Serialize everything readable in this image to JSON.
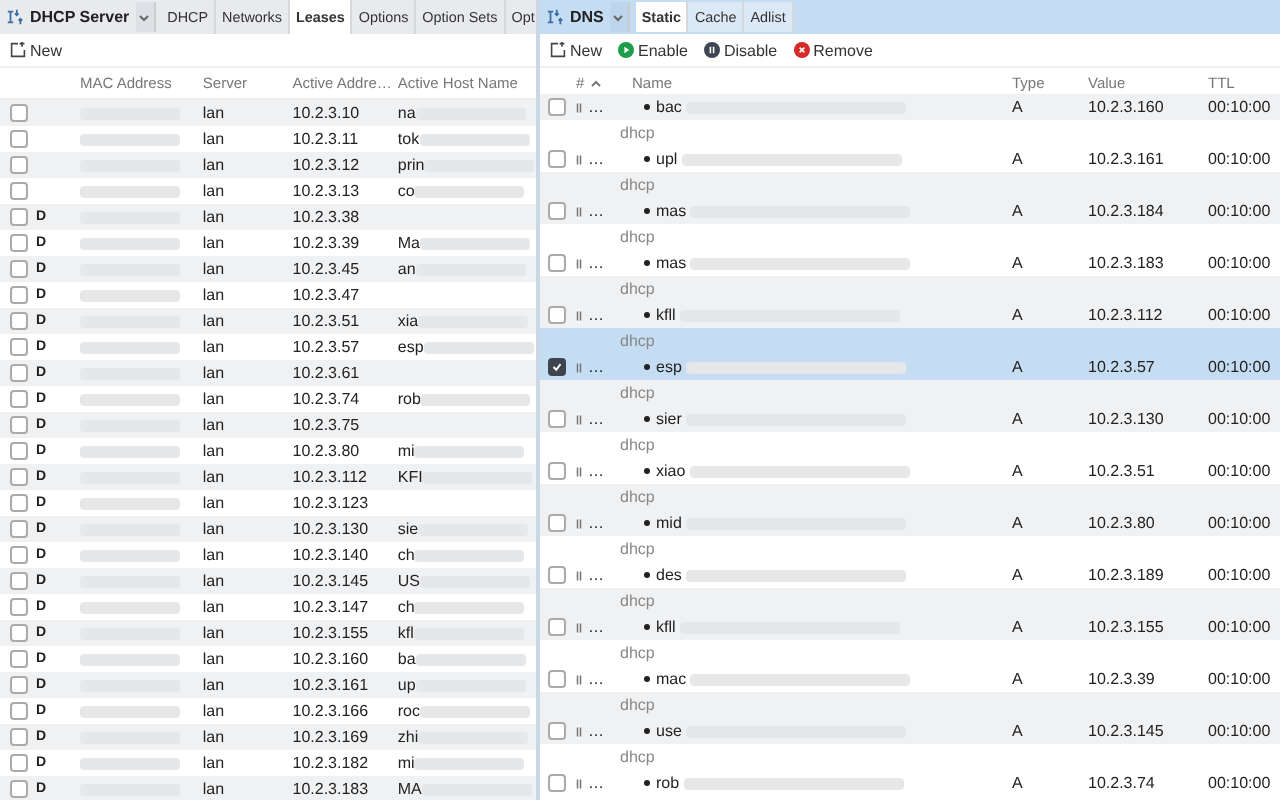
{
  "dhcp_panel": {
    "title": "DHCP Server",
    "tabs": [
      {
        "label": "DHCP",
        "selected": false
      },
      {
        "label": "Networks",
        "selected": false
      },
      {
        "label": "Leases",
        "selected": true
      },
      {
        "label": "Options",
        "selected": false
      },
      {
        "label": "Option Sets",
        "selected": false
      },
      {
        "label": "Opt",
        "selected": false
      }
    ],
    "toolbar": [
      "New"
    ],
    "table": {
      "columns": [
        "MAC Address",
        "Server",
        "Active Addre…",
        "Active Host Name"
      ],
      "rows": [
        {
          "checked": false,
          "flag": "",
          "server": "lan",
          "address": "10.2.3.10",
          "host": "na"
        },
        {
          "checked": false,
          "flag": "",
          "server": "lan",
          "address": "10.2.3.11",
          "host": "tok"
        },
        {
          "checked": false,
          "flag": "",
          "server": "lan",
          "address": "10.2.3.12",
          "host": "prin"
        },
        {
          "checked": false,
          "flag": "",
          "server": "lan",
          "address": "10.2.3.13",
          "host": "co"
        },
        {
          "checked": false,
          "flag": "D",
          "server": "lan",
          "address": "10.2.3.38",
          "host": ""
        },
        {
          "checked": false,
          "flag": "D",
          "server": "lan",
          "address": "10.2.3.39",
          "host": "Ma"
        },
        {
          "checked": false,
          "flag": "D",
          "server": "lan",
          "address": "10.2.3.45",
          "host": "an"
        },
        {
          "checked": false,
          "flag": "D",
          "server": "lan",
          "address": "10.2.3.47",
          "host": ""
        },
        {
          "checked": false,
          "flag": "D",
          "server": "lan",
          "address": "10.2.3.51",
          "host": "xia"
        },
        {
          "checked": false,
          "flag": "D",
          "server": "lan",
          "address": "10.2.3.57",
          "host": "esp"
        },
        {
          "checked": false,
          "flag": "D",
          "server": "lan",
          "address": "10.2.3.61",
          "host": ""
        },
        {
          "checked": false,
          "flag": "D",
          "server": "lan",
          "address": "10.2.3.74",
          "host": "rob"
        },
        {
          "checked": false,
          "flag": "D",
          "server": "lan",
          "address": "10.2.3.75",
          "host": ""
        },
        {
          "checked": false,
          "flag": "D",
          "server": "lan",
          "address": "10.2.3.80",
          "host": "mi"
        },
        {
          "checked": false,
          "flag": "D",
          "server": "lan",
          "address": "10.2.3.112",
          "host": "KFI"
        },
        {
          "checked": false,
          "flag": "D",
          "server": "lan",
          "address": "10.2.3.123",
          "host": ""
        },
        {
          "checked": false,
          "flag": "D",
          "server": "lan",
          "address": "10.2.3.130",
          "host": "sie"
        },
        {
          "checked": false,
          "flag": "D",
          "server": "lan",
          "address": "10.2.3.140",
          "host": "ch"
        },
        {
          "checked": false,
          "flag": "D",
          "server": "lan",
          "address": "10.2.3.145",
          "host": "US"
        },
        {
          "checked": false,
          "flag": "D",
          "server": "lan",
          "address": "10.2.3.147",
          "host": "ch"
        },
        {
          "checked": false,
          "flag": "D",
          "server": "lan",
          "address": "10.2.3.155",
          "host": "kfl"
        },
        {
          "checked": false,
          "flag": "D",
          "server": "lan",
          "address": "10.2.3.160",
          "host": "ba"
        },
        {
          "checked": false,
          "flag": "D",
          "server": "lan",
          "address": "10.2.3.161",
          "host": "up"
        },
        {
          "checked": false,
          "flag": "D",
          "server": "lan",
          "address": "10.2.3.166",
          "host": "roc"
        },
        {
          "checked": false,
          "flag": "D",
          "server": "lan",
          "address": "10.2.3.169",
          "host": "zhi"
        },
        {
          "checked": false,
          "flag": "D",
          "server": "lan",
          "address": "10.2.3.182",
          "host": "mi"
        },
        {
          "checked": false,
          "flag": "D",
          "server": "lan",
          "address": "10.2.3.183",
          "host": "MA"
        }
      ]
    }
  },
  "dns_panel": {
    "title": "DNS",
    "tabs": [
      {
        "label": "Static",
        "selected": true
      },
      {
        "label": "Cache",
        "selected": false
      },
      {
        "label": "Adlist",
        "selected": false
      }
    ],
    "toolbar": [
      {
        "kind": "new",
        "label": "New"
      },
      {
        "kind": "enable",
        "label": "Enable"
      },
      {
        "kind": "disable",
        "label": "Disable"
      },
      {
        "kind": "remove",
        "label": "Remove"
      }
    ],
    "table": {
      "columns": [
        "#",
        "Name",
        "Type",
        "Value",
        "TTL"
      ],
      "rows": [
        {
          "checked": false,
          "selected": false,
          "order": "…",
          "name": "bac",
          "type": "A",
          "value": "10.2.3.160",
          "ttl": "00:10:00"
        },
        {
          "comment": "dhcp",
          "checked": false,
          "selected": false,
          "order": "…",
          "name": "upl",
          "type": "A",
          "value": "10.2.3.161",
          "ttl": "00:10:00"
        },
        {
          "comment": "dhcp",
          "checked": false,
          "selected": false,
          "order": "…",
          "name": "mas",
          "type": "A",
          "value": "10.2.3.184",
          "ttl": "00:10:00"
        },
        {
          "comment": "dhcp",
          "checked": false,
          "selected": false,
          "order": "…",
          "name": "mas",
          "type": "A",
          "value": "10.2.3.183",
          "ttl": "00:10:00"
        },
        {
          "comment": "dhcp",
          "checked": false,
          "selected": false,
          "order": "…",
          "name": "kfll",
          "type": "A",
          "value": "10.2.3.112",
          "ttl": "00:10:00"
        },
        {
          "comment": "dhcp",
          "checked": true,
          "selected": true,
          "order": "…",
          "name": "esp",
          "type": "A",
          "value": "10.2.3.57",
          "ttl": "00:10:00"
        },
        {
          "comment": "dhcp",
          "checked": false,
          "selected": false,
          "order": "…",
          "name": "sier",
          "type": "A",
          "value": "10.2.3.130",
          "ttl": "00:10:00"
        },
        {
          "comment": "dhcp",
          "checked": false,
          "selected": false,
          "order": "…",
          "name": "xiao",
          "type": "A",
          "value": "10.2.3.51",
          "ttl": "00:10:00"
        },
        {
          "comment": "dhcp",
          "checked": false,
          "selected": false,
          "order": "…",
          "name": "mid",
          "type": "A",
          "value": "10.2.3.80",
          "ttl": "00:10:00"
        },
        {
          "comment": "dhcp",
          "checked": false,
          "selected": false,
          "order": "…",
          "name": "des",
          "type": "A",
          "value": "10.2.3.189",
          "ttl": "00:10:00"
        },
        {
          "comment": "dhcp",
          "checked": false,
          "selected": false,
          "order": "…",
          "name": "kfll",
          "type": "A",
          "value": "10.2.3.155",
          "ttl": "00:10:00"
        },
        {
          "comment": "dhcp",
          "checked": false,
          "selected": false,
          "order": "…",
          "name": "mac",
          "type": "A",
          "value": "10.2.3.39",
          "ttl": "00:10:00"
        },
        {
          "comment": "dhcp",
          "checked": false,
          "selected": false,
          "order": "…",
          "name": "use",
          "type": "A",
          "value": "10.2.3.145",
          "ttl": "00:10:00"
        },
        {
          "comment": "dhcp",
          "checked": false,
          "selected": false,
          "order": "…",
          "name": "rob",
          "type": "A",
          "value": "10.2.3.74",
          "ttl": "00:10:00"
        }
      ]
    }
  }
}
